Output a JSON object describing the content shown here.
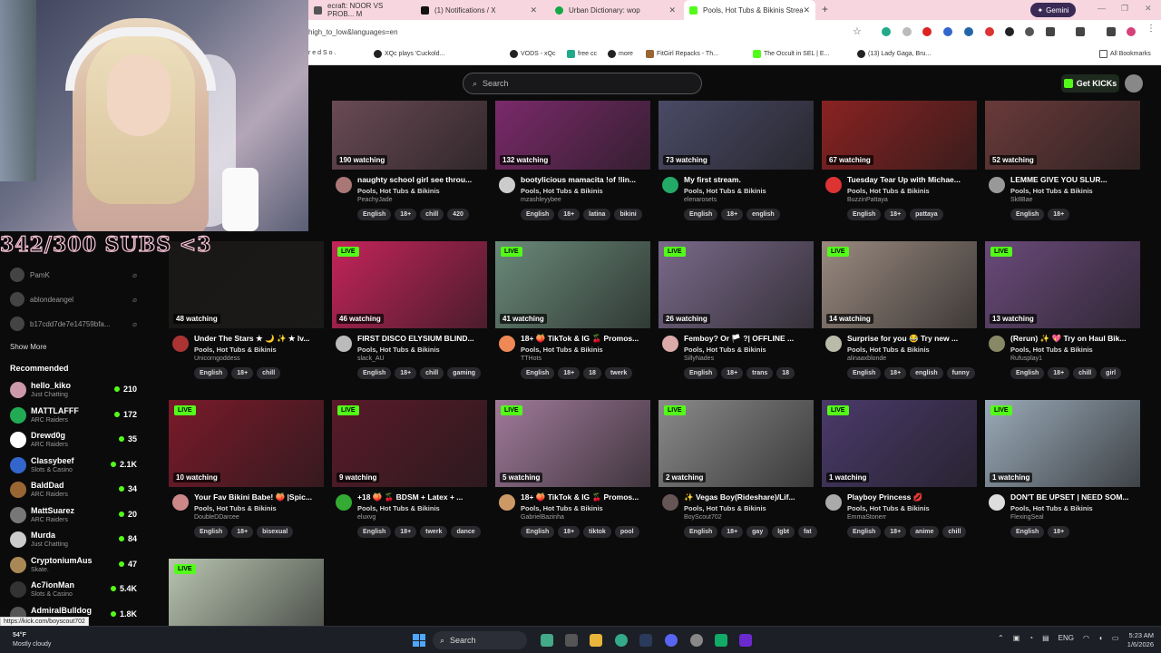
{
  "browser": {
    "tabs": [
      {
        "label": "ecraft: NOOR VS PROB... M",
        "color": "#555"
      },
      {
        "label": "(1) Notifications / X",
        "color": "#111"
      },
      {
        "label": "Urban Dictionary: wop",
        "color": "#1a4"
      },
      {
        "label": "Pools, Hot Tubs & Bikinis Strea",
        "color": "#53fc18"
      }
    ],
    "gemini_label": "Gemini",
    "url": "high_to_low&languages=en",
    "bookmarks": [
      "r e d   S o .",
      "XQc plays 'Cuckold...",
      "VODS - xQc",
      "free cc",
      "more",
      "FitGirl Repacks - Th...",
      "The Occult in SEL | E...",
      "(13) Lady Gaga, Bru...",
      "All Bookmarks"
    ]
  },
  "site": {
    "search_placeholder": "Search",
    "get_kicks": "Get KICKs",
    "live_label": "LIVE"
  },
  "overlay": {
    "sub_goal": "342/300 SUBS <3"
  },
  "sidebar": {
    "following": [
      "PamK",
      "ablondeangel",
      "b17cdd7de7e14759bfa..."
    ],
    "show_more": "Show More",
    "recommended_title": "Recommended",
    "recommended": [
      {
        "name": "hello_kiko",
        "category": "Just Chatting",
        "viewers": "210",
        "color": "#c9a"
      },
      {
        "name": "MATTLAFFF",
        "category": "ARC Raiders",
        "viewers": "172",
        "color": "#2a5"
      },
      {
        "name": "Drewd0g",
        "category": "ARC Raiders",
        "viewers": "35",
        "color": "#fff"
      },
      {
        "name": "Classybeef",
        "category": "Slots & Casino",
        "viewers": "2.1K",
        "color": "#36c"
      },
      {
        "name": "BaldDad",
        "category": "ARC Raiders",
        "viewers": "34",
        "color": "#963"
      },
      {
        "name": "MattSuarez",
        "category": "ARC Raiders",
        "viewers": "20",
        "color": "#777"
      },
      {
        "name": "Murda",
        "category": "Just Chatting",
        "viewers": "84",
        "color": "#ccc"
      },
      {
        "name": "CryptoniumAus",
        "category": "Skate.",
        "viewers": "47",
        "color": "#a85"
      },
      {
        "name": "Ac7ionMan",
        "category": "Slots & Casino",
        "viewers": "5.4K",
        "color": "#333"
      },
      {
        "name": "AdmiralBulldog",
        "category": "",
        "viewers": "1.8K",
        "color": "#555"
      }
    ]
  },
  "streams": [
    {
      "watching": "190 watching",
      "title": "naughty school girl see throu...",
      "category": "Pools, Hot Tubs & Bikinis",
      "channel": "PeachyJade",
      "tags": [
        "English",
        "18+",
        "chill",
        "420"
      ],
      "thumb": "#6a4a55",
      "avatar": "#a77",
      "live": false
    },
    {
      "watching": "132 watching",
      "title": "bootylicious mamacita !of !lin...",
      "category": "Pools, Hot Tubs & Bikinis",
      "channel": "mzashleyybee",
      "tags": [
        "English",
        "18+",
        "latina",
        "bikini"
      ],
      "thumb": "#7a2a6a",
      "avatar": "#ccc",
      "live": false
    },
    {
      "watching": "73 watching",
      "title": "My first stream.",
      "category": "Pools, Hot Tubs & Bikinis",
      "channel": "elenarosets",
      "tags": [
        "English",
        "18+",
        "english"
      ],
      "thumb": "#4a4a66",
      "avatar": "#2a6",
      "live": false
    },
    {
      "watching": "67 watching",
      "title": "Tuesday Tear Up with Michae...",
      "category": "Pools, Hot Tubs & Bikinis",
      "channel": "BuzzinPattaya",
      "tags": [
        "English",
        "18+",
        "pattaya"
      ],
      "thumb": "#8a2222",
      "avatar": "#d33",
      "live": false
    },
    {
      "watching": "52 watching",
      "title": "LEMME GIVE YOU SLUR...",
      "category": "Pools, Hot Tubs & Bikinis",
      "channel": "Sk8Bae",
      "tags": [
        "English",
        "18+"
      ],
      "thumb": "#6a3a3a",
      "avatar": "#999",
      "live": false
    },
    {
      "watching": "48 watching",
      "title": "Under The Stars ★ 🌙 ✨ ★ lv...",
      "category": "Pools, Hot Tubs & Bikinis",
      "channel": "Unicorngoddess",
      "tags": [
        "English",
        "18+",
        "chill"
      ],
      "thumb": "#1a1816",
      "avatar": "#a33",
      "live": false
    },
    {
      "watching": "46 watching",
      "title": "FIRST DISCO ELYSIUM BLIND...",
      "category": "Pools, Hot Tubs & Bikinis",
      "channel": "slack_AU",
      "tags": [
        "English",
        "18+",
        "chill",
        "gaming"
      ],
      "thumb": "#c4245a",
      "avatar": "#bbb",
      "live": true
    },
    {
      "watching": "41 watching",
      "title": "18+ 🍑 TikTok & IG 🍒 Promos...",
      "category": "Pools, Hot Tubs & Bikinis",
      "channel": "TTHots",
      "tags": [
        "English",
        "18+",
        "18",
        "twerk"
      ],
      "thumb": "#6a8a7a",
      "avatar": "#e85",
      "live": true
    },
    {
      "watching": "26 watching",
      "title": "Femboy? Or 🏳️ ?| OFFLINE ...",
      "category": "Pools, Hot Tubs & Bikinis",
      "channel": "SillyNades",
      "tags": [
        "English",
        "18+",
        "trans",
        "18"
      ],
      "thumb": "#7a6a8a",
      "avatar": "#daa",
      "live": true
    },
    {
      "watching": "14 watching",
      "title": "Surprise for you 😂 Try new ...",
      "category": "Pools, Hot Tubs & Bikinis",
      "channel": "alinaaxblonde",
      "tags": [
        "English",
        "18+",
        "english",
        "funny"
      ],
      "thumb": "#9a8a80",
      "avatar": "#bba",
      "live": true
    },
    {
      "watching": "13 watching",
      "title": "(Rerun) ✨ 💖 Try on Haul Bik...",
      "category": "Pools, Hot Tubs & Bikinis",
      "channel": "Rufusplay1",
      "tags": [
        "English",
        "18+",
        "chill",
        "girl"
      ],
      "thumb": "#6a4a7a",
      "avatar": "#886",
      "live": true
    },
    {
      "watching": "10 watching",
      "title": "Your Fav Bikini Babe! 🍑 |Spic...",
      "category": "Pools, Hot Tubs & Bikinis",
      "channel": "DoubleDDarcee",
      "tags": [
        "English",
        "18+",
        "bisexual"
      ],
      "thumb": "#7a1a2a",
      "avatar": "#c88",
      "live": true
    },
    {
      "watching": "9 watching",
      "title": "+18 🍑 🍒 BDSM + Latex + ...",
      "category": "Pools, Hot Tubs & Bikinis",
      "channel": "eluxvg",
      "tags": [
        "English",
        "18+",
        "twerk",
        "dance"
      ],
      "thumb": "#5a1a2a",
      "avatar": "#3a3",
      "live": true
    },
    {
      "watching": "5 watching",
      "title": "18+ 🍑 TikTok & IG 🍒 Promos...",
      "category": "Pools, Hot Tubs & Bikinis",
      "channel": "GabrielBazinha",
      "tags": [
        "English",
        "18+",
        "tiktok",
        "pool"
      ],
      "thumb": "#a07a9a",
      "avatar": "#c96",
      "live": true
    },
    {
      "watching": "2 watching",
      "title": "✨ Vegas Boy(Rideshare)/Lif...",
      "category": "Pools, Hot Tubs & Bikinis",
      "channel": "BoyScout702",
      "tags": [
        "English",
        "18+",
        "gay",
        "lgbt",
        "fat"
      ],
      "thumb": "#8a8a8a",
      "avatar": "#655",
      "live": true
    },
    {
      "watching": "1 watching",
      "title": "Playboy Princess 💋",
      "category": "Pools, Hot Tubs & Bikinis",
      "channel": "EmmaStonerr",
      "tags": [
        "English",
        "18+",
        "anime",
        "chill"
      ],
      "thumb": "#4a3a6a",
      "avatar": "#aaa",
      "live": true
    },
    {
      "watching": "1 watching",
      "title": "DON'T BE UPSET | NEED SOM...",
      "category": "Pools, Hot Tubs & Bikinis",
      "channel": "FlexingSeal",
      "tags": [
        "English",
        "18+"
      ],
      "thumb": "#9aaab8",
      "avatar": "#ddd",
      "live": true
    },
    {
      "watching": "",
      "title": "",
      "category": "",
      "channel": "",
      "tags": [],
      "thumb": "#b8c4b0",
      "avatar": "#000",
      "live": true
    }
  ],
  "status_url": "https://kick.com/boyscout702",
  "taskbar": {
    "temp": "54°F",
    "weather": "Mostly cloudy",
    "search": "Search",
    "lang": "ENG",
    "time": "5:23 AM",
    "date": "1/6/2026"
  }
}
